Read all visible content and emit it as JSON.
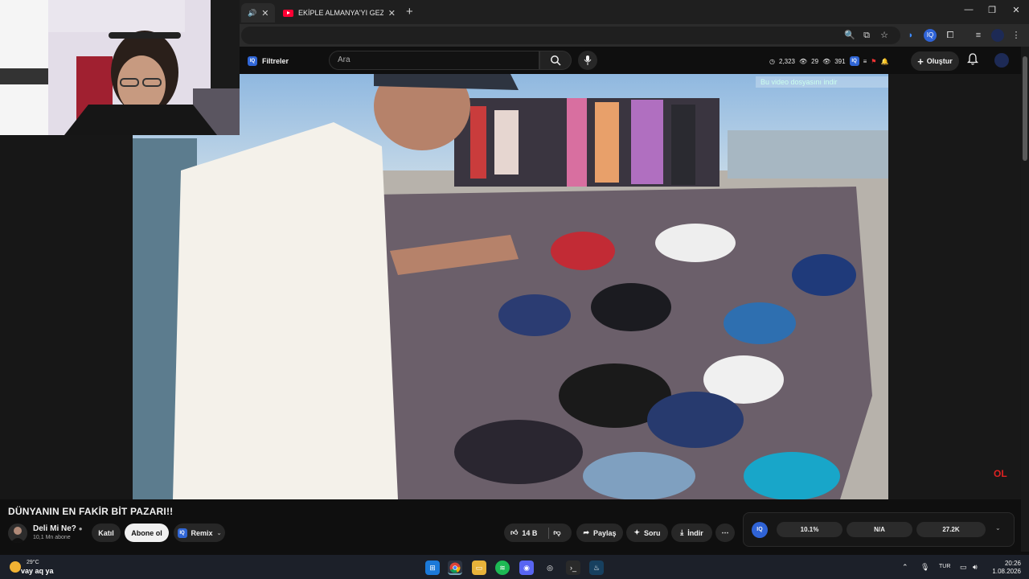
{
  "browser": {
    "tabs": [
      {
        "title": ""
      },
      {
        "title": "EKİPLE ALMANYA'YI GEZİYORUZ"
      }
    ],
    "new_tab": "+"
  },
  "yt": {
    "filters_label": "Filtreler",
    "iq_badge": "IQ",
    "search_placeholder": "Ara",
    "stats": {
      "views": "2,323",
      "watching": "29",
      "other": "391"
    },
    "create_label": "Oluştur",
    "download_banner": "Bu video dosyasını indir",
    "watermark": "OL"
  },
  "video_info": {
    "title": "DÜNYANIN EN FAKİR BİT PAZARI!!",
    "channel": "Deli Mi Ne?",
    "subscribers": "10,1 Mn abone",
    "join": "Katıl",
    "subscribe": "Abone ol",
    "remix": "Remix",
    "likes": "14 B",
    "share": "Paylaş",
    "ask": "Soru",
    "download": "İndir",
    "more": "⋯"
  },
  "iq_panel": {
    "stat1": "10.1%",
    "stat2": "N/A",
    "stat3": "27.2K"
  },
  "taskbar": {
    "weather_temp": "29°C",
    "weather_desc": "vay aq ya",
    "lang": "TUR",
    "time": "20:26",
    "date": "1.08.2026"
  }
}
